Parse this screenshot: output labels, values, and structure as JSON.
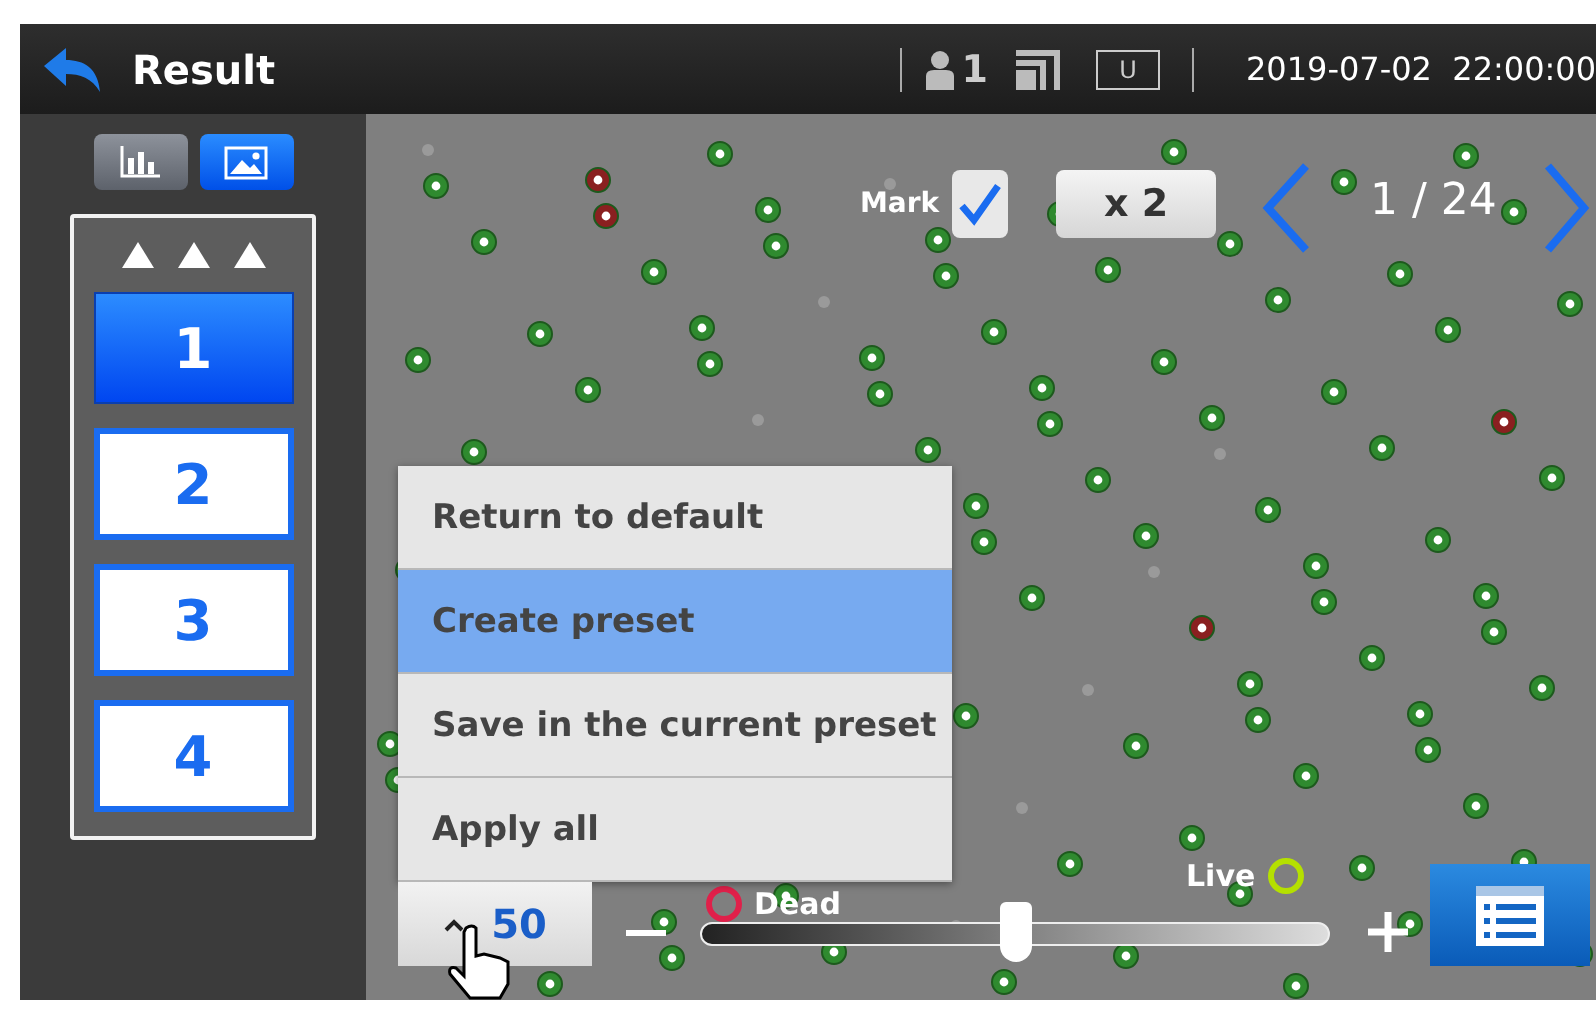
{
  "header": {
    "title": "Result",
    "user_count": "1",
    "mode": "U",
    "datetime": "2019-07-02  22:00:00"
  },
  "view_toggle": [
    {
      "kind": "chart",
      "selected": false
    },
    {
      "kind": "image",
      "selected": true
    }
  ],
  "presets": [
    {
      "label": "1",
      "selected": true
    },
    {
      "label": "2",
      "selected": false
    },
    {
      "label": "3",
      "selected": false
    },
    {
      "label": "4",
      "selected": false
    }
  ],
  "mark": {
    "label": "Mark",
    "checked": true
  },
  "zoom_button": "x 2",
  "pager": "1 / 24",
  "menu": [
    {
      "label": "Return to default",
      "selected": false
    },
    {
      "label": "Create preset",
      "selected": true
    },
    {
      "label": "Save in the current preset",
      "selected": false
    },
    {
      "label": "Apply all",
      "selected": false
    }
  ],
  "threshold": {
    "value": "50",
    "level": 0.5
  },
  "legend": [
    {
      "label": "Dead",
      "color": "#e0204a"
    },
    {
      "label": "Live",
      "color": "#b5e000"
    }
  ]
}
